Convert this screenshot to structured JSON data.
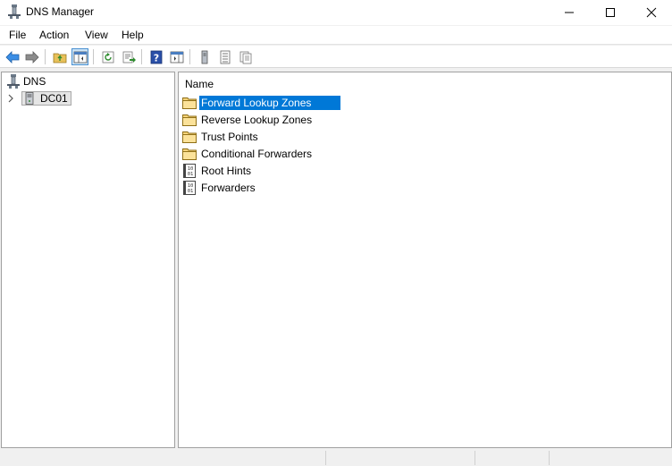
{
  "window": {
    "title": "DNS Manager"
  },
  "menu": {
    "items": [
      "File",
      "Action",
      "View",
      "Help"
    ]
  },
  "toolbar": {
    "buttons": [
      {
        "name": "back-arrow-icon"
      },
      {
        "name": "forward-arrow-icon"
      },
      {
        "name": "up-folder-icon"
      },
      {
        "name": "show-hide-tree-icon"
      },
      {
        "name": "refresh-icon"
      },
      {
        "name": "export-list-icon"
      },
      {
        "name": "help-icon"
      },
      {
        "name": "action-pane-icon"
      },
      {
        "name": "server-icon"
      },
      {
        "name": "list-view-icon"
      },
      {
        "name": "copy-icon"
      }
    ]
  },
  "tree": {
    "root_label": "DNS",
    "server_label": "DC01"
  },
  "list": {
    "column_header": "Name",
    "items": [
      {
        "label": "Forward Lookup Zones",
        "icon": "folder-icon",
        "selected": true
      },
      {
        "label": "Reverse Lookup Zones",
        "icon": "folder-icon",
        "selected": false
      },
      {
        "label": "Trust Points",
        "icon": "folder-icon",
        "selected": false
      },
      {
        "label": "Conditional Forwarders",
        "icon": "folder-icon",
        "selected": false
      },
      {
        "label": "Root Hints",
        "icon": "binary-doc-icon",
        "selected": false
      },
      {
        "label": "Forwarders",
        "icon": "binary-doc-icon",
        "selected": false
      }
    ]
  },
  "colors": {
    "selection": "#0078d7",
    "accent": "#4a90d0"
  }
}
